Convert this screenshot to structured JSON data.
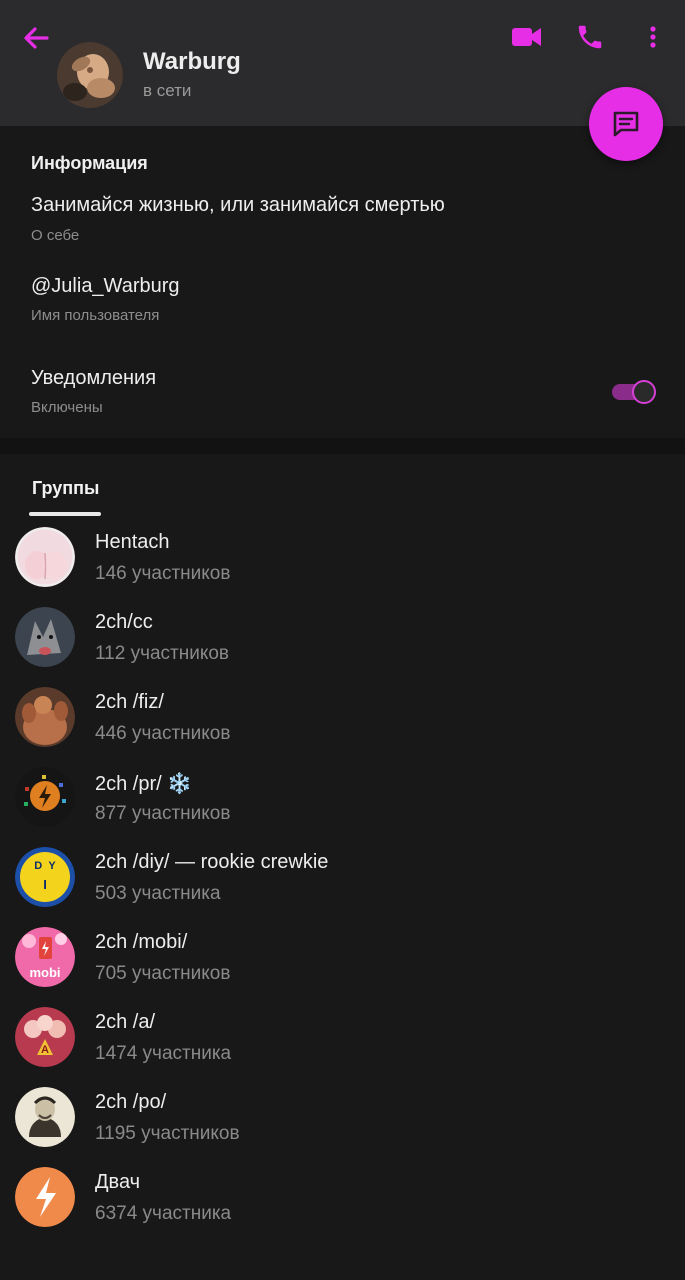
{
  "header": {
    "title": "Warburg",
    "status": "в сети",
    "accent": "#e62ee6"
  },
  "icons": {
    "back": "arrow-left-icon",
    "video": "video-camera-icon",
    "call": "phone-icon",
    "more": "more-vert-icon",
    "message": "message-icon"
  },
  "info": {
    "section_title": "Информация",
    "bio": "Занимайся жизнью, или занимайся смертью",
    "bio_label": "О себе",
    "username": "@Julia_Warburg",
    "username_label": "Имя пользователя",
    "notifications": "Уведомления",
    "notifications_state": "Включены",
    "notifications_on": true
  },
  "tabs": {
    "groups": "Группы"
  },
  "groups": [
    {
      "name": "Hentach",
      "members": "146 участников"
    },
    {
      "name": "2ch/cc",
      "members": "112 участников"
    },
    {
      "name": "2ch /fiz/",
      "members": "446 участников"
    },
    {
      "name": "2ch /pr/ ❄️",
      "members": "877 участников"
    },
    {
      "name": "2ch /diy/ — rookie crewkie",
      "members": "503 участника"
    },
    {
      "name": "2ch /mobi/",
      "members": "705 участников"
    },
    {
      "name": "2ch /a/",
      "members": "1474 участника"
    },
    {
      "name": "2ch /po/",
      "members": "1195 участников"
    },
    {
      "name": "Двач",
      "members": "6374 участника"
    }
  ]
}
